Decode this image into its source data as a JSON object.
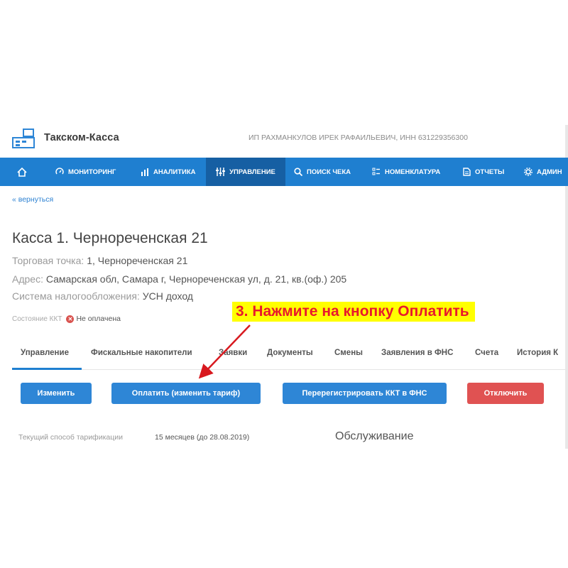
{
  "header": {
    "logo_text": "Такском-Касса",
    "company": "ИП РАХМАНКУЛОВ ИРЕК РАФАИЛЬЕВИЧ, ИНН 631229356300"
  },
  "nav": {
    "items": [
      {
        "label": "",
        "icon": "home-icon"
      },
      {
        "label": "МОНИТОРИНГ",
        "icon": "gauge-icon"
      },
      {
        "label": "АНАЛИТИКА",
        "icon": "bar-chart-icon"
      },
      {
        "label": "УПРАВЛЕНИЕ",
        "icon": "sliders-icon",
        "active": true
      },
      {
        "label": "ПОИСК ЧЕКА",
        "icon": "search-icon"
      },
      {
        "label": "НОМЕНКЛАТУРА",
        "icon": "list-icon"
      },
      {
        "label": "ОТЧЕТЫ",
        "icon": "document-icon"
      },
      {
        "label": "АДМИН",
        "icon": "gear-icon"
      }
    ]
  },
  "page": {
    "back_link": "« вернуться",
    "title": "Касса 1. Чернореченская 21",
    "point_label": "Торговая точка:",
    "point_value": "1, Чернореченская 21",
    "address_label": "Адрес:",
    "address_value": "Самарская обл, Самара г, Черноречeнская ул, д. 21, кв.(оф.) 205",
    "tax_label": "Система налогообложения:",
    "tax_value": "УСН доход",
    "state_label": "Состояние ККТ",
    "state_value": "Не оплачена"
  },
  "callout": "3. Нажмите на кнопку Оплатить",
  "tabs": [
    "Управление",
    "Фискальные накопители",
    "Заявки",
    "Документы",
    "Смены",
    "Заявления в ФНС",
    "Счета",
    "История К"
  ],
  "buttons": {
    "edit": "Изменить",
    "pay": "Оплатить (изменить тариф)",
    "reregister": "Перерегистрировать ККТ в ФНС",
    "disable": "Отключить"
  },
  "tarif": {
    "label": "Текущий способ тарификации",
    "value": "15 месяцев (до 28.08.2019)",
    "service": "Обслуживание"
  },
  "colors": {
    "nav_bg": "#1f7fd0",
    "button_blue": "#2e86d6",
    "button_red": "#e05252",
    "callout_bg": "#ffff00",
    "callout_text": "#e8192c"
  }
}
